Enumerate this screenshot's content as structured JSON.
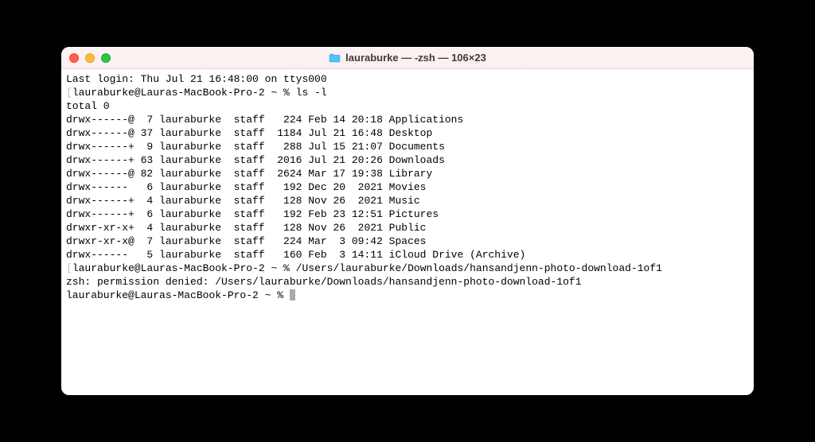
{
  "window": {
    "title": "lauraburke — -zsh — 106×23"
  },
  "terminal": {
    "last_login": "Last login: Thu Jul 21 16:48:00 on ttys000",
    "prompt1_host": "lauraburke@Lauras-MacBook-Pro-2 ~ % ",
    "cmd1": "ls -l",
    "total": "total 0",
    "rows": [
      "drwx------@  7 lauraburke  staff   224 Feb 14 20:18 Applications",
      "drwx------@ 37 lauraburke  staff  1184 Jul 21 16:48 Desktop",
      "drwx------+  9 lauraburke  staff   288 Jul 15 21:07 Documents",
      "drwx------+ 63 lauraburke  staff  2016 Jul 21 20:26 Downloads",
      "drwx------@ 82 lauraburke  staff  2624 Mar 17 19:38 Library",
      "drwx------   6 lauraburke  staff   192 Dec 20  2021 Movies",
      "drwx------+  4 lauraburke  staff   128 Nov 26  2021 Music",
      "drwx------+  6 lauraburke  staff   192 Feb 23 12:51 Pictures",
      "drwxr-xr-x+  4 lauraburke  staff   128 Nov 26  2021 Public",
      "drwxr-xr-x@  7 lauraburke  staff   224 Mar  3 09:42 Spaces",
      "drwx------   5 lauraburke  staff   160 Feb  3 14:11 iCloud Drive (Archive)"
    ],
    "prompt2_host": "lauraburke@Lauras-MacBook-Pro-2 ~ % ",
    "cmd2": "/Users/lauraburke/Downloads/hansandjenn-photo-download-1of1",
    "error": "zsh: permission denied: /Users/lauraburke/Downloads/hansandjenn-photo-download-1of1",
    "prompt3_host": "lauraburke@Lauras-MacBook-Pro-2 ~ % "
  }
}
